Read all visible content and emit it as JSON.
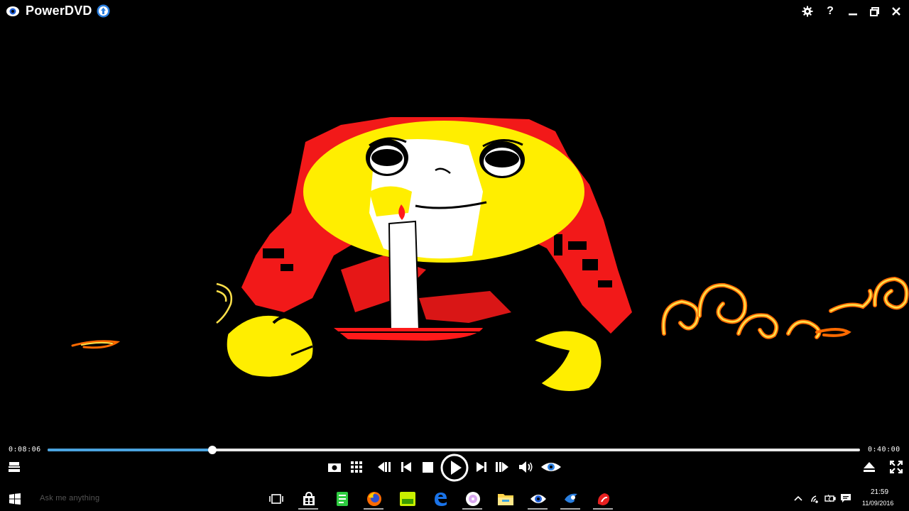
{
  "window": {
    "title": "PowerDVD",
    "buttons": {
      "settings_icon": "gear-icon",
      "help_label": "?",
      "minimize_icon": "minimize-icon",
      "restore_icon": "restore-icon",
      "close_icon": "close-icon"
    }
  },
  "playback": {
    "elapsed": "0:08:06",
    "total": "0:40:00",
    "progress": 0.2027
  },
  "controls": {
    "left": "menu-icon",
    "center": [
      "snapshot-icon",
      "grid-icon",
      "rewind-icon",
      "previous-icon",
      "stop-icon",
      "play-icon",
      "next-icon",
      "step-forward-icon",
      "volume-icon",
      "trueteheory-eye-icon"
    ],
    "right": [
      "eject-icon",
      "fullscreen-icon"
    ]
  },
  "taskbar": {
    "search_placeholder": "Ask me anything",
    "apps": [
      "task-view-icon",
      "store-icon",
      "green-app-icon",
      "firefox-icon",
      "yellow-green-app-icon",
      "edge-icon",
      "media-app-icon",
      "file-explorer-icon",
      "powerdvd-icon",
      "blue-app-icon",
      "red-app-icon"
    ],
    "tray": {
      "time": "21:59",
      "date": "11/09/2016"
    }
  },
  "colors": {
    "accent": "#4aa3df",
    "video_red": "#ff1a1a",
    "video_yellow": "#ffee00",
    "background": "#000000"
  }
}
